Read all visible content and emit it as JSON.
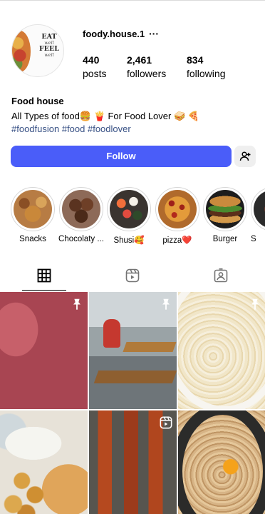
{
  "profile": {
    "username": "foody.house.1",
    "more": "···",
    "avatar_logo": [
      "EAT",
      "well",
      "FEEL",
      "well"
    ],
    "stats": {
      "posts": {
        "value": "440",
        "label": "posts"
      },
      "followers": {
        "value": "2,461",
        "label": "followers"
      },
      "following": {
        "value": "834",
        "label": "following"
      }
    },
    "bio": {
      "name": "Food house",
      "line": "All Types of food🍔 🍟 For Food Lover 🥪 🍕",
      "hashtags": "#foodfusion #food #foodlover"
    },
    "buttons": {
      "follow": "Follow",
      "suggest_icon": "add-person-icon"
    }
  },
  "highlights": [
    {
      "label": "Snacks"
    },
    {
      "label": "Chocolaty ..."
    },
    {
      "label": "Shusi🥰"
    },
    {
      "label": "pizza❤️"
    },
    {
      "label": "Burger"
    },
    {
      "label": "S"
    }
  ],
  "tabs": [
    {
      "icon": "grid-icon",
      "active": true
    },
    {
      "icon": "reels-icon",
      "active": false
    },
    {
      "icon": "tagged-icon",
      "active": false
    }
  ],
  "posts": [
    {
      "badge": "pin-icon"
    },
    {
      "badge": "pin-icon"
    },
    {
      "badge": "pin-icon"
    },
    {
      "badge": ""
    },
    {
      "badge": "reel-icon"
    },
    {
      "badge": ""
    }
  ],
  "colors": {
    "follow_button": "#4a5df9",
    "hashtag": "#385185"
  }
}
